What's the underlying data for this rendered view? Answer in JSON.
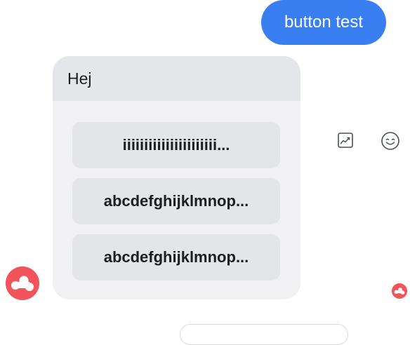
{
  "sent_message": {
    "text": "button test"
  },
  "template": {
    "title": "Hej",
    "buttons": [
      {
        "label": "iiiiiiiiiiiiiiiiiiiiii..."
      },
      {
        "label": "abcdefghijklmnop..."
      },
      {
        "label": "abcdefghijklmnop..."
      }
    ]
  },
  "actions": {
    "gif_icon": "gif-picker-icon",
    "emoji_icon": "emoji-smile-icon"
  },
  "colors": {
    "sent_bubble": "#3a7ff1",
    "card_background": "#f1f1f4",
    "card_header": "#e5e6ea",
    "button_background": "#e4e5e9",
    "avatar": "#f1545a"
  }
}
